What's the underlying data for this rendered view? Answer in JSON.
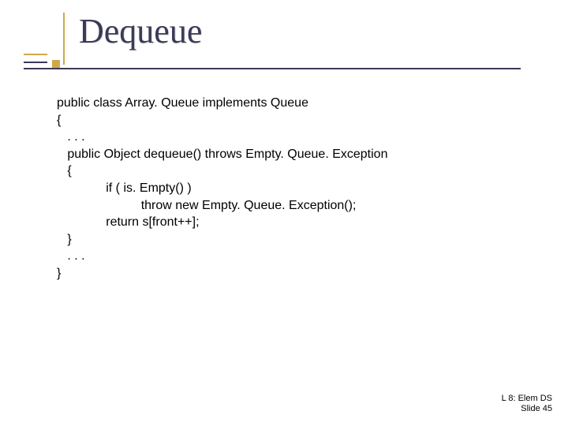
{
  "title": "Dequeue",
  "code": "public class Array. Queue implements Queue\n{\n   . . .\n   public Object dequeue() throws Empty. Queue. Exception\n   {\n              if ( is. Empty() )\n                        throw new Empty. Queue. Exception();\n              return s[front++];\n   }\n   . . .\n}",
  "footer": {
    "line1": "L 8: Elem DS",
    "line2": "Slide 45"
  }
}
